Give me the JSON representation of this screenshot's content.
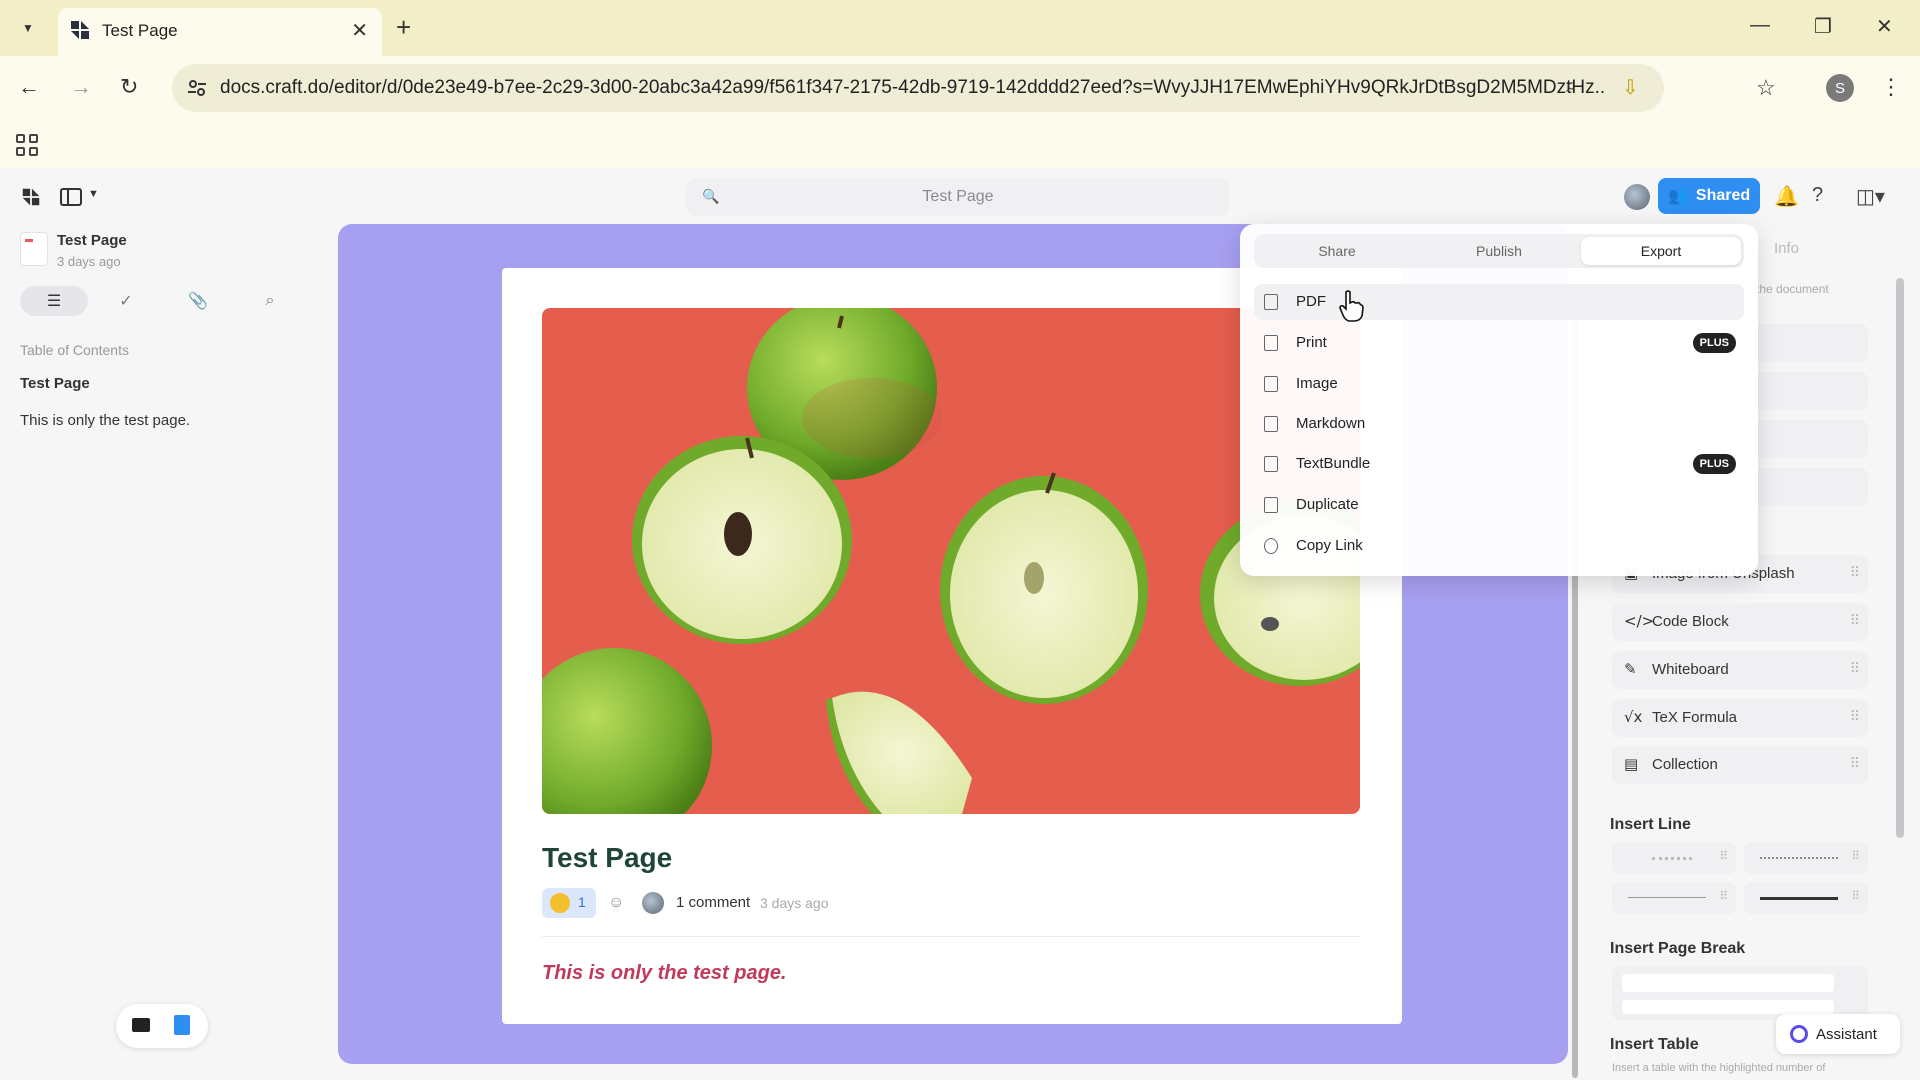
{
  "browser": {
    "tab_title": "Test Page",
    "url": "docs.craft.do/editor/d/0de23e49-b7ee-2c29-3d00-20abc3a42a99/f561f347-2175-42db-9719-142dddd27eed?s=WvyJJH17EMwEphiYHv9QRkJrDtBsgD2M5MDztHz...",
    "profile_initial": "S"
  },
  "app": {
    "search_placeholder": "Test Page",
    "shared_label": "Shared"
  },
  "sidebar": {
    "doc_title": "Test Page",
    "doc_date": "3 days ago",
    "toc_label": "Table of Contents",
    "toc_items": [
      "Test Page",
      "This is only the test page."
    ]
  },
  "document": {
    "title": "Test Page",
    "reaction_count": "1",
    "comments": "1 comment",
    "time": "3 days ago",
    "body": "This is only the test page."
  },
  "popover": {
    "tabs": [
      "Share",
      "Publish",
      "Export"
    ],
    "active_tab": "Export",
    "items": [
      {
        "label": "PDF",
        "icon": "pdf-icon",
        "badge": ""
      },
      {
        "label": "Print",
        "icon": "print-icon",
        "badge": "PLUS"
      },
      {
        "label": "Image",
        "icon": "image-icon",
        "badge": ""
      },
      {
        "label": "Markdown",
        "icon": "markdown-icon",
        "badge": ""
      },
      {
        "label": "TextBundle",
        "icon": "textbundle-icon",
        "badge": "PLUS"
      },
      {
        "label": "Duplicate",
        "icon": "duplicate-icon",
        "badge": ""
      },
      {
        "label": "Copy Link",
        "icon": "link-icon",
        "badge": ""
      }
    ]
  },
  "right_panel": {
    "info_tab": "Info",
    "desc_fragment": "the document",
    "blocks": [
      {
        "label": "Image from Unsplash",
        "icon": "image-icon"
      },
      {
        "label": "Code Block",
        "icon": "code-icon"
      },
      {
        "label": "Whiteboard",
        "icon": "whiteboard-icon"
      },
      {
        "label": "TeX Formula",
        "icon": "formula-icon"
      },
      {
        "label": "Collection",
        "icon": "collection-icon"
      }
    ],
    "insert_line": "Insert Line",
    "insert_page_break": "Insert Page Break",
    "insert_table": "Insert Table",
    "insert_table_hint": "Insert a table with the highlighted number of",
    "assistant": "Assistant"
  },
  "colors": {
    "canvas": "#a79ff0",
    "shared_button": "#2f8ef1",
    "hero_background": "#e55d4d",
    "body_text": "#c23a5b",
    "title_text": "#1e4538"
  }
}
